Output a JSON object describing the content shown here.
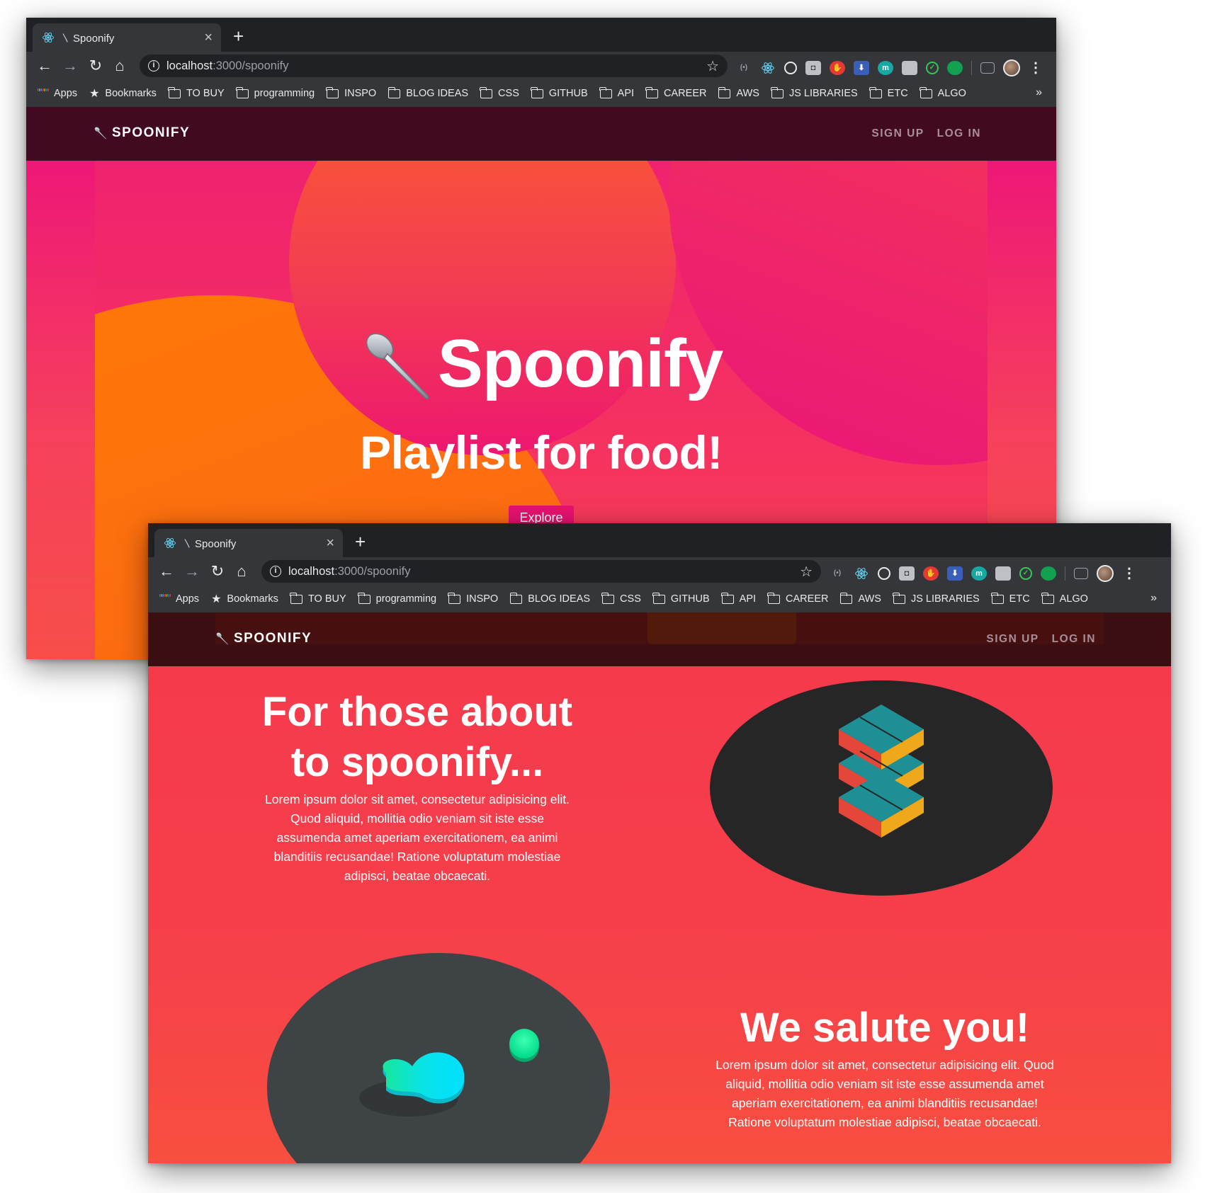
{
  "browser": {
    "tab_title": "Spoonify",
    "url_host": "localhost",
    "url_path": ":3000/spoonify",
    "bookmarks": [
      "Apps",
      "Bookmarks",
      "TO BUY",
      "programming",
      "INSPO",
      "BLOG IDEAS",
      "CSS",
      "GITHUB",
      "API",
      "CAREER",
      "AWS",
      "JS LIBRARIES",
      "ETC",
      "ALGO"
    ],
    "more": "»"
  },
  "nav": {
    "brand": "SPOONIFY",
    "sign_up": "SIGN UP",
    "log_in": "LOG IN"
  },
  "hero": {
    "title": "Spoonify",
    "subtitle": "Playlist for food!",
    "button": "Explore"
  },
  "features": [
    {
      "title_line1": "For those about",
      "title_line2": "to spoonify...",
      "text": "Lorem ipsum dolor sit amet, consectetur adipisicing elit. Quod aliquid, mollitia odio veniam sit iste esse assumenda amet aperiam exercitationem, ea animi blanditiis recusandae! Ratione voluptatum molestiae adipisci, beatae obcaecati."
    },
    {
      "title": "We salute you!",
      "text": "Lorem ipsum dolor sit amet, consectetur adipisicing elit. Quod aliquid, mollitia odio veniam sit iste esse assumenda amet aperiam exercitationem, ea animi blanditiis recusandae! Ratione voluptatum molestiae adipisci, beatae obcaecati."
    }
  ],
  "colors": {
    "chrome_dark": "#202124",
    "chrome_toolbar": "#35363a",
    "nav_bg": "#420a20",
    "hero_pink": "#ee1777",
    "accent_orange": "#ff7a06",
    "explore_button": "#e8126f",
    "section_red": "#f53a4c",
    "oval_dark": "#262626"
  },
  "icons": [
    "react-favicon",
    "spoon-icon",
    "back-arrow-icon",
    "forward-arrow-icon",
    "reload-icon",
    "home-icon",
    "info-icon",
    "star-icon",
    "apps-grid-icon",
    "folder-icon",
    "kebab-menu-icon",
    "isometric-blocks-illustration",
    "blob-toggle-illustration"
  ]
}
